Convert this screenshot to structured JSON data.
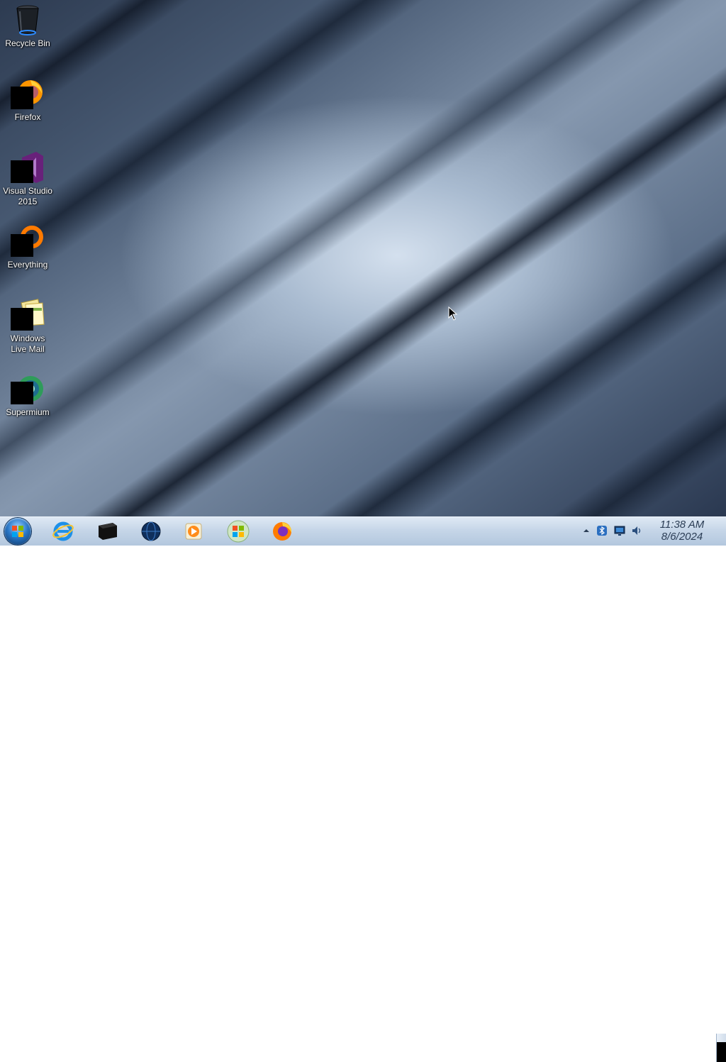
{
  "desktop": {
    "icons": [
      {
        "label": "Recycle Bin",
        "icon": "recycle-bin-icon"
      },
      {
        "label": "Firefox",
        "icon": "firefox-icon"
      },
      {
        "label": "Visual Studio 2015",
        "icon": "visual-studio-icon"
      },
      {
        "label": "Everything",
        "icon": "everything-search-icon"
      },
      {
        "label": "Windows Live Mail",
        "icon": "windows-live-mail-icon"
      },
      {
        "label": "Supermium",
        "icon": "supermium-browser-icon"
      }
    ]
  },
  "taskbar": {
    "start": "windows-start-orb-icon",
    "pinned": [
      "internet-explorer-icon",
      "command-prompt-icon",
      "network-globe-icon",
      "windows-media-player-icon",
      "windows-logo-icon",
      "firefox-icon"
    ],
    "tray": [
      "show-hidden-icons-chevron",
      "bluetooth-icon",
      "network-monitor-icon",
      "volume-icon"
    ],
    "clock": {
      "time": "11:38 AM",
      "date": "8/6/2024"
    }
  },
  "colors": {
    "taskbar_top": "#dfe9f4",
    "taskbar_bottom": "#b3c7de",
    "clock_text": "#2b3d55",
    "desktop_highlight": "#d4e0ee",
    "desktop_shadow": "#2a3850"
  }
}
